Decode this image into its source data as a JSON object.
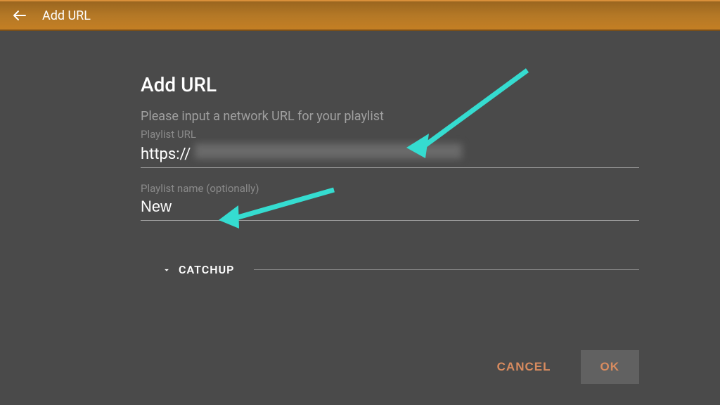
{
  "header": {
    "title": "Add URL"
  },
  "dialog": {
    "title": "Add URL",
    "subtitle": "Please input a network URL for your playlist",
    "url_label": "Playlist URL",
    "url_prefix": "https://",
    "name_label": "Playlist name (optionally)",
    "name_value": "New"
  },
  "catchup": {
    "label": "CATCHUP"
  },
  "actions": {
    "cancel": "CANCEL",
    "ok": "OK"
  },
  "colors": {
    "accent": "#b47826",
    "action_text": "#d88b5f",
    "annotation": "#35dcd0"
  }
}
